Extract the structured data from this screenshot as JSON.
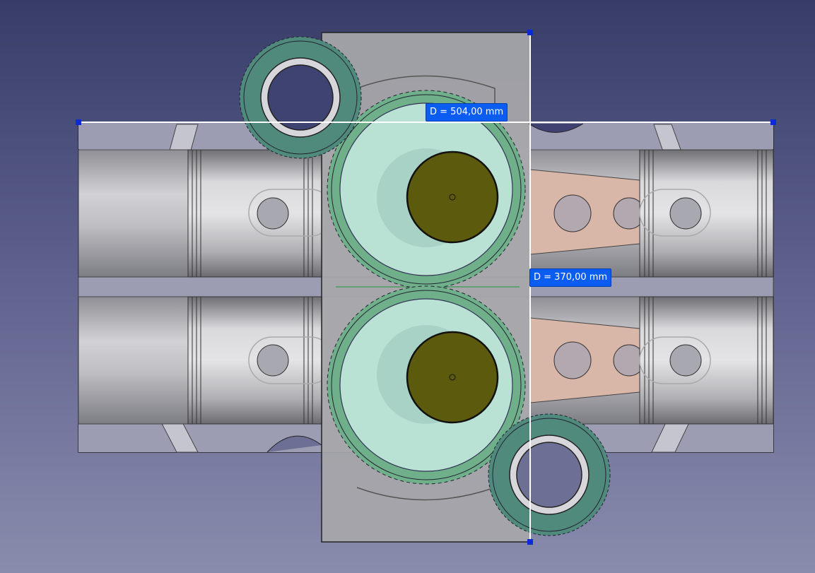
{
  "view": {
    "name": "3d-view",
    "background_top": "#383d68",
    "background_bottom": "#8a8cad"
  },
  "dimensions": {
    "horizontal": {
      "label": "D = 504,00 mm",
      "value": 504.0,
      "unit": "mm"
    },
    "vertical": {
      "label": "D = 370,00 mm",
      "value": 370.0,
      "unit": "mm"
    }
  },
  "colors": {
    "block": "#c8c8cc",
    "crankcase_plate": "#a9a9ab",
    "gear_fill": "#6fb08a",
    "gear_disc": "#bfe6da",
    "shaft": "#5c5a0c",
    "con_rod": "#d8b7a8",
    "selection_blue": "#0b5cf0",
    "idler_gear": "#4f8a7c"
  }
}
